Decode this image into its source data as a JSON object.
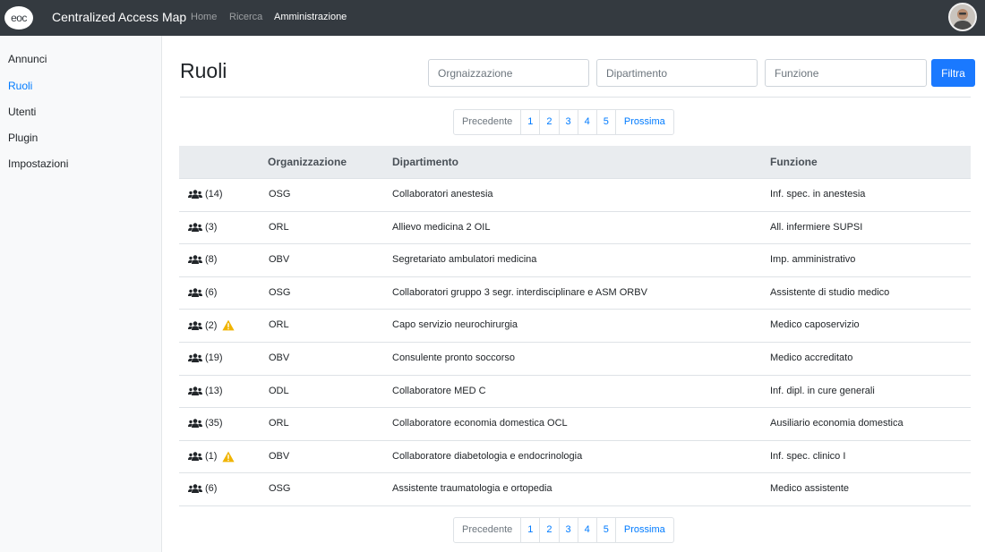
{
  "navbar": {
    "logo_text": "eoc",
    "brand": "Centralized Access Map",
    "links": [
      "Home",
      "Ricerca",
      "Amministrazione"
    ],
    "active_link": "Amministrazione"
  },
  "sidebar": {
    "items": [
      {
        "label": "Annunci"
      },
      {
        "label": "Ruoli"
      },
      {
        "label": "Utenti"
      },
      {
        "label": "Plugin"
      },
      {
        "label": "Impostazioni"
      }
    ],
    "active": "Ruoli"
  },
  "page": {
    "title": "Ruoli",
    "filters": {
      "organizzazione_placeholder": "Orgnaizzazione",
      "dipartimento_placeholder": "Dipartimento",
      "funzione_placeholder": "Funzione",
      "button_label": "Filtra"
    }
  },
  "pagination": {
    "prev": "Precedente",
    "pages": [
      "1",
      "2",
      "3",
      "4",
      "5"
    ],
    "next": "Prossima"
  },
  "table": {
    "headers": [
      "",
      "Organizzazione",
      "Dipartimento",
      "Funzione"
    ],
    "rows": [
      {
        "count": "(14)",
        "warning": false,
        "org": "OSG",
        "dept": "Collaboratori anestesia",
        "func": "Inf. spec. in anestesia"
      },
      {
        "count": "(3)",
        "warning": false,
        "org": "ORL",
        "dept": "Allievo medicina 2 OIL",
        "func": "All. infermiere SUPSI"
      },
      {
        "count": "(8)",
        "warning": false,
        "org": "OBV",
        "dept": "Segretariato ambulatori medicina",
        "func": "Imp. amministrativo"
      },
      {
        "count": "(6)",
        "warning": false,
        "org": "OSG",
        "dept": "Collaboratori gruppo 3 segr. interdisciplinare e ASM ORBV",
        "func": "Assistente di studio medico"
      },
      {
        "count": "(2)",
        "warning": true,
        "org": "ORL",
        "dept": "Capo servizio neurochirurgia",
        "func": "Medico caposervizio"
      },
      {
        "count": "(19)",
        "warning": false,
        "org": "OBV",
        "dept": "Consulente pronto soccorso",
        "func": "Medico accreditato"
      },
      {
        "count": "(13)",
        "warning": false,
        "org": "ODL",
        "dept": "Collaboratore MED C",
        "func": "Inf. dipl. in cure generali"
      },
      {
        "count": "(35)",
        "warning": false,
        "org": "ORL",
        "dept": "Collaboratore economia domestica OCL",
        "func": "Ausiliario economia domestica"
      },
      {
        "count": "(1)",
        "warning": true,
        "org": "OBV",
        "dept": "Collaboratore diabetologia e endocrinologia",
        "func": "Inf. spec. clinico I"
      },
      {
        "count": "(6)",
        "warning": false,
        "org": "OSG",
        "dept": "Assistente traumatologia e ortopedia",
        "func": "Medico assistente"
      }
    ]
  },
  "icons": {
    "users": "users-icon",
    "warning": "warning-icon",
    "warning_color": "#f0b400"
  },
  "colors": {
    "navbar_bg": "#343a40",
    "accent": "#007bff",
    "button": "#1a79ff"
  }
}
